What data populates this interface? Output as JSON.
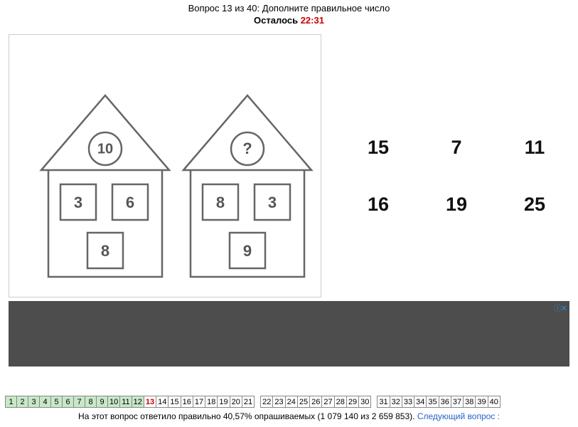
{
  "header": {
    "title": "Вопрос 13 из 40: Дополните правильное число",
    "remain_label": "Осталось",
    "timer": "22:31"
  },
  "puzzle": {
    "house1": {
      "roof": "10",
      "win1": "3",
      "win2": "6",
      "door": "8"
    },
    "house2": {
      "roof": "?",
      "win1": "8",
      "win2": "3",
      "door": "9"
    }
  },
  "answers": [
    "15",
    "7",
    "11",
    "16",
    "19",
    "25"
  ],
  "nav": {
    "total": 40,
    "current": 13,
    "answered_upto": 12
  },
  "footer": {
    "stats": "На этот вопрос ответило правильно 40,57% опрашиваемых (1 079 140 из 2 659 853).",
    "next_label": "Следующий вопрос :"
  },
  "ad": {
    "close": "ⓘ✕"
  }
}
